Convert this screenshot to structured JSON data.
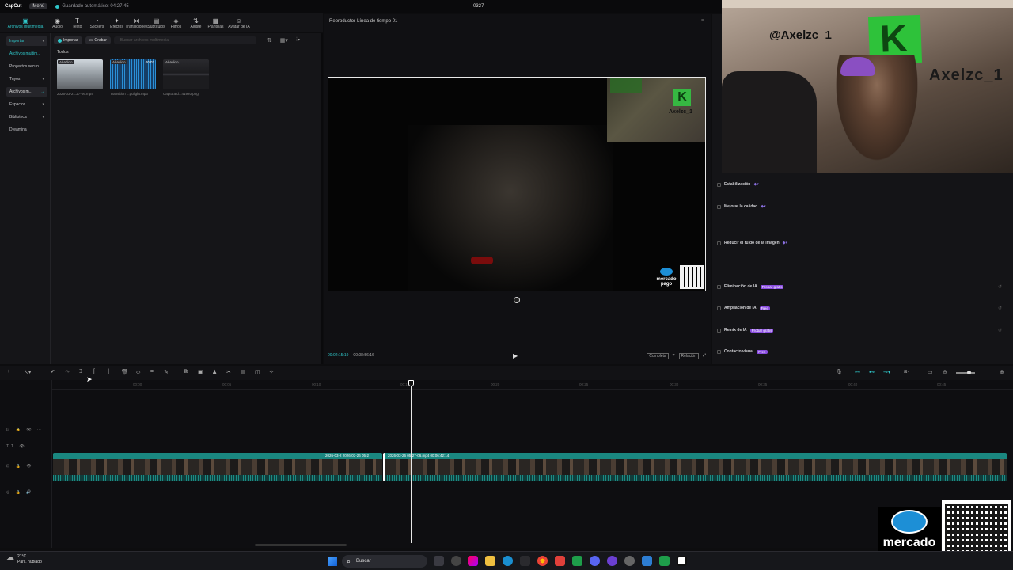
{
  "titlebar": {
    "app": "CapCut",
    "menu": "Menú",
    "autosave": "Guardado automático: 04:27:45",
    "project": "0327"
  },
  "media_tabs": [
    {
      "label": "Archivos multimedia",
      "icon": "media-icon"
    },
    {
      "label": "Audio",
      "icon": "audio-icon"
    },
    {
      "label": "Texto",
      "icon": "text-icon"
    },
    {
      "label": "Stickers",
      "icon": "sticker-icon"
    },
    {
      "label": "Efectos",
      "icon": "effects-icon"
    },
    {
      "label": "Transiciones",
      "icon": "transition-icon"
    },
    {
      "label": "Subtítulos",
      "icon": "subtitles-icon"
    },
    {
      "label": "Filtros",
      "icon": "filter-icon"
    },
    {
      "label": "Ajuste",
      "icon": "adjust-icon"
    },
    {
      "label": "Plantillas",
      "icon": "templates-icon"
    },
    {
      "label": "Avatar de IA",
      "icon": "avatar-icon"
    }
  ],
  "sidebar": {
    "items": [
      {
        "label": "Importar"
      },
      {
        "label": "Archivos multim..."
      },
      {
        "label": "Proyectos secun..."
      },
      {
        "label": "Tuyos"
      },
      {
        "label": "Archivos m..."
      },
      {
        "label": "Espacios"
      },
      {
        "label": "Biblioteca"
      },
      {
        "label": "Dreamina"
      }
    ]
  },
  "media": {
    "import_label": "Importar",
    "record_label": "Grabar",
    "search_placeholder": "Buscar archivos multimedia",
    "section": "Todos",
    "items": [
      {
        "tag": "Añadido",
        "caption": "2026-03-2...27-06.mp4",
        "duration": ""
      },
      {
        "tag": "Añadido",
        "caption": "Transition ...pulight.mp3",
        "duration": "00:03"
      },
      {
        "tag": "Añadido",
        "caption": "Captura d...41920.png",
        "duration": ""
      }
    ]
  },
  "player": {
    "title": "Reproductor-Línea de tiempo 01",
    "current_time": "00:02:15:19",
    "total_time": "00:08:56:16",
    "btn_full": "Completa",
    "btn_ratio": "Relación",
    "watermark_name": "Axelzc_1",
    "watermark_brand": "mercado pago"
  },
  "inspector": {
    "rows": [
      {
        "label": "Estabilización",
        "badge": "",
        "has_reset": false
      },
      {
        "label": "Mejorar la calidad",
        "badge": "",
        "has_reset": false
      },
      {
        "label": "Reducir el ruido de la imagen",
        "badge": "",
        "has_reset": false
      },
      {
        "label": "Eliminación de IA",
        "badge": "Probar gratis",
        "has_reset": true
      },
      {
        "label": "Ampliación de IA",
        "badge": "Free",
        "has_reset": true
      },
      {
        "label": "Remix de IA",
        "badge": "Probar gratis",
        "has_reset": true
      },
      {
        "label": "Contacto visual",
        "badge": "Free",
        "has_reset": false
      }
    ]
  },
  "webcam": {
    "instagram": "@Axelzc_1",
    "channel": "Axelzc_1"
  },
  "timeline": {
    "ticks": [
      "00:00",
      "00:05",
      "00:10",
      "00:15",
      "00:20",
      "00:25",
      "00:30",
      "00:35",
      "00:40",
      "00:45"
    ],
    "clip1_label": "2026-03-2  2026-03-26 05-2",
    "clip2_label": "2026-03-26 05-27-06.mp4  00:06:42:14"
  },
  "overlay": {
    "brand_line1": "mercado",
    "brand_line2": "pago"
  },
  "taskbar": {
    "temp": "21°C",
    "weather": "Parc. nublado",
    "search": "Buscar"
  }
}
